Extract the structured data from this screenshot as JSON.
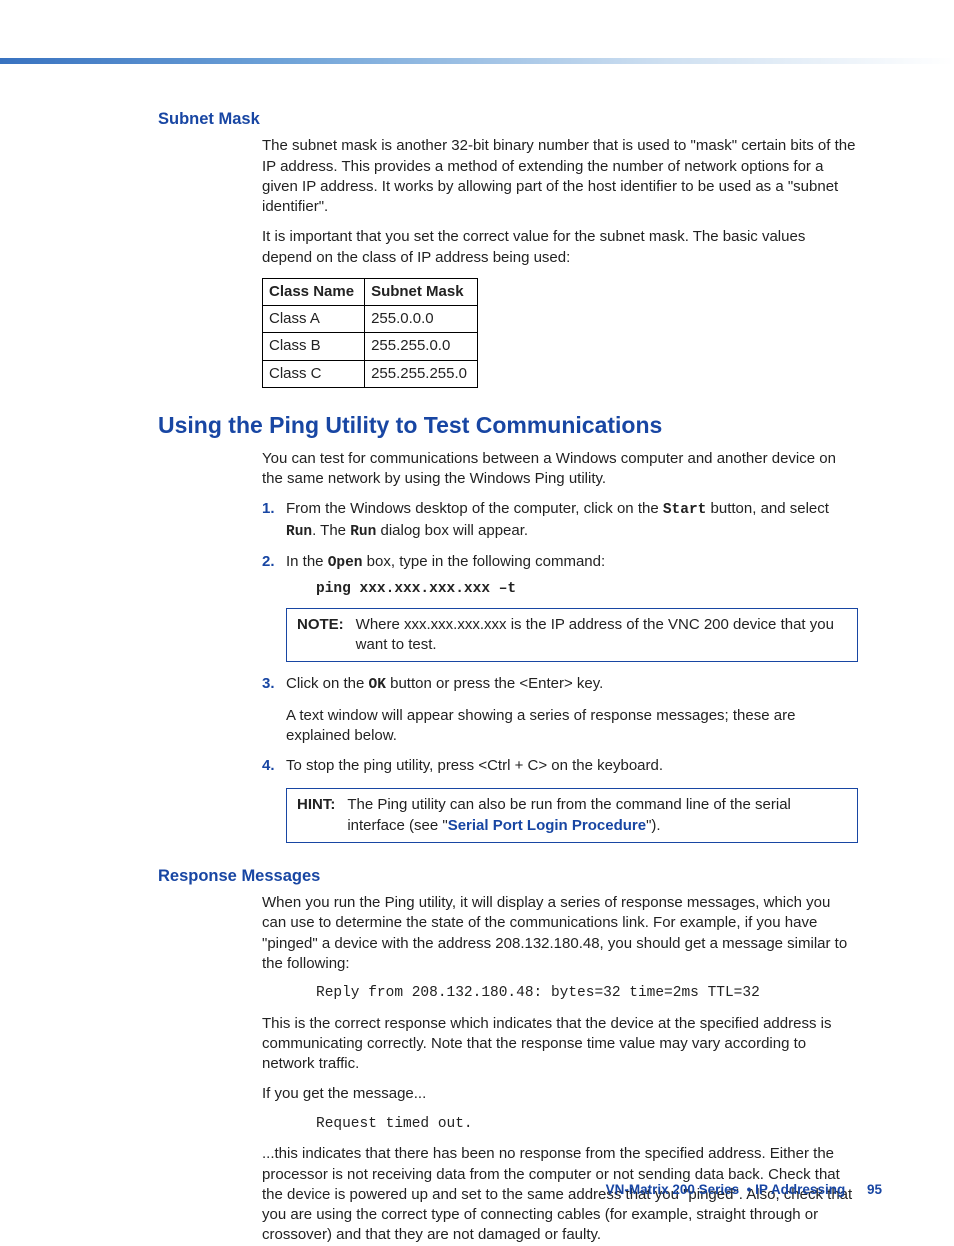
{
  "section1": {
    "heading": "Subnet Mask",
    "p1": "The subnet mask is another 32-bit binary number that is used to \"mask\" certain bits of the IP address. This provides a method of extending the number of network options for a given IP address. It works by allowing part of the host identifier to be used as a \"subnet identifier\".",
    "p2": "It is important that you set the correct value for the subnet mask. The basic values depend on the class of IP address being used:",
    "table": {
      "headers": [
        "Class Name",
        "Subnet Mask"
      ],
      "rows": [
        [
          "Class A",
          "255.0.0.0"
        ],
        [
          "Class B",
          "255.255.0.0"
        ],
        [
          "Class C",
          "255.255.255.0"
        ]
      ]
    }
  },
  "section2": {
    "heading": "Using the Ping Utility to Test Communications",
    "intro": "You can test for communications between a Windows computer and another device on the same network by using the Windows Ping utility.",
    "step1": {
      "a": "From the Windows desktop of the computer, click on the ",
      "b": "Start",
      "c": " button, and select ",
      "d": "Run",
      "e": ". The ",
      "f": "Run",
      "g": " dialog box will appear."
    },
    "step2": {
      "a": "In the ",
      "b": "Open",
      "c": " box, type in the following command:",
      "cmd": "ping xxx.xxx.xxx.xxx –t"
    },
    "note": {
      "label": "NOTE:",
      "text": "Where xxx.xxx.xxx.xxx is the IP address of the VNC 200 device that you want to test."
    },
    "step3": {
      "a": "Click on the ",
      "b": "OK",
      "c": " button or press the <",
      "d": "Enter",
      "e": "> key.",
      "sub": "A text window will appear showing a series of response messages; these are explained below."
    },
    "step4": {
      "a": "To stop the ping utility, press <",
      "b": "Ctrl + C",
      "c": "> on the keyboard."
    },
    "hint": {
      "label": "HINT:",
      "a": "The Ping utility can also be run from the command line of the serial interface (see \"",
      "link": "Serial Port Login Procedure",
      "b": "\")."
    }
  },
  "section3": {
    "heading": "Response Messages",
    "p1": "When you run the Ping utility, it will display a series of response messages, which you can use to determine the state of the communications link. For example, if you have \"pinged\" a device with the address 208.132.180.48, you should get a message similar to the following:",
    "code1": "Reply from 208.132.180.48: bytes=32 time=2ms TTL=32",
    "p2": "This is the correct response which indicates that the device at the specified address is communicating correctly. Note that the response time value may vary according to network traffic.",
    "p3": "If you get the message...",
    "code2": "Request timed out.",
    "p4": "...this indicates that there has been no response from the specified address. Either the processor is not receiving data from the computer or not sending data back. Check that the device is powered up and set to the same address that you \"pinged\". Also, check that you are using the correct type of connecting cables (for example, straight through or crossover) and that they are not damaged or faulty."
  },
  "footer": {
    "product": "VN-Matrix 200 Series",
    "bullet": "•",
    "chapter": "IP Addressing",
    "page": "95"
  }
}
